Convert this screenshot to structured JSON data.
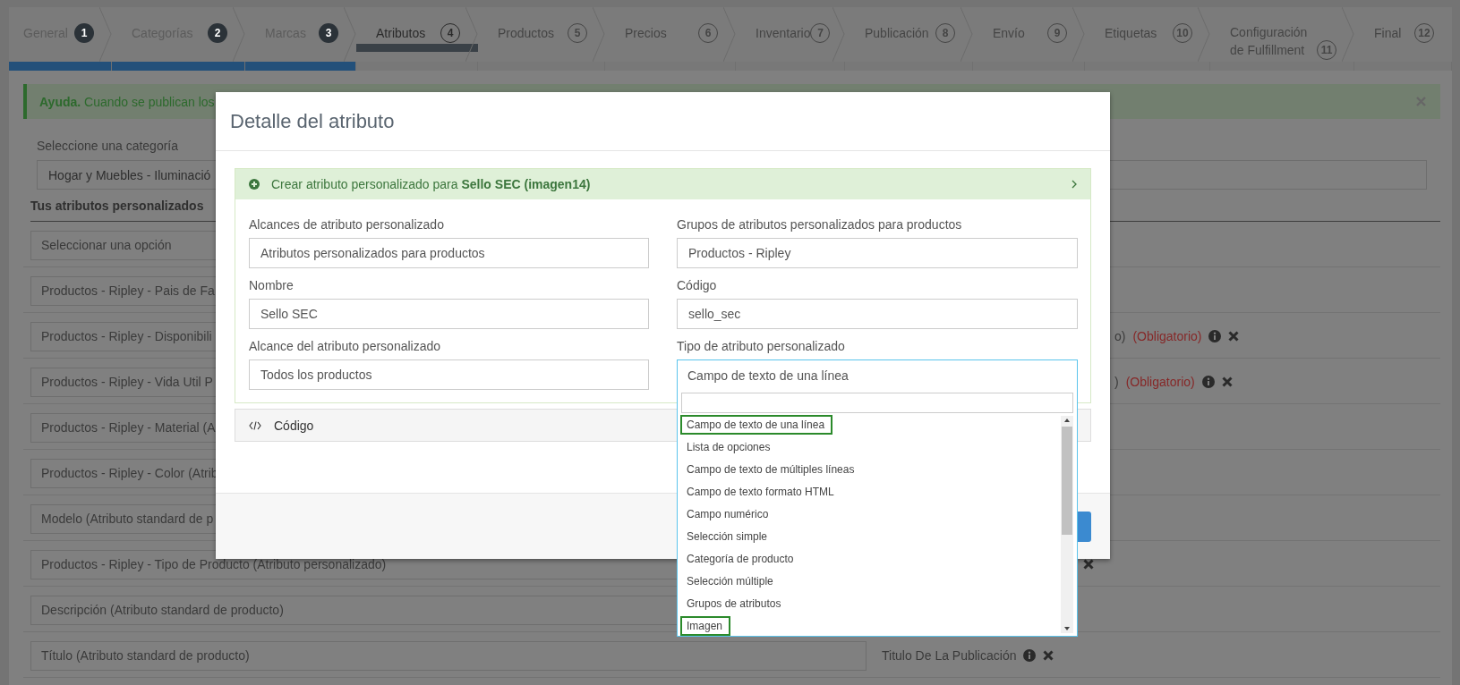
{
  "wizard": {
    "steps": [
      {
        "label": "General",
        "number": "1",
        "done": true,
        "selected": false
      },
      {
        "label": "Categorías",
        "number": "2",
        "done": true,
        "selected": false
      },
      {
        "label": "Marcas",
        "number": "3",
        "done": true,
        "selected": false
      },
      {
        "label": "Atributos",
        "number": "4",
        "done": false,
        "selected": true
      },
      {
        "label": "Productos",
        "number": "5",
        "done": false,
        "selected": false
      },
      {
        "label": "Precios",
        "number": "6",
        "done": false,
        "selected": false
      },
      {
        "label": "Inventario",
        "number": "7",
        "done": false,
        "selected": false
      },
      {
        "label": "Publicación",
        "number": "8",
        "done": false,
        "selected": false
      },
      {
        "label": "Envío",
        "number": "9",
        "done": false,
        "selected": false
      },
      {
        "label": "Etiquetas",
        "number": "10",
        "done": false,
        "selected": false
      },
      {
        "label": "Configuración de Fulfillment",
        "number": "11",
        "done": false,
        "selected": false
      },
      {
        "label": "Final",
        "number": "12",
        "done": false,
        "selected": false
      }
    ]
  },
  "help_alert": {
    "title": "Ayuda.",
    "text": "Cuando se publican los"
  },
  "category": {
    "label": "Seleccione una categoría",
    "value": "Hogar y Muebles - Iluminació"
  },
  "section_title": "Tus atributos personalizados",
  "rows": [
    {
      "text": "Seleccionar una opción"
    },
    {
      "text": "Productos - Ripley - Pais de Fa"
    },
    {
      "text": "Productos - Ripley - Disponibili",
      "right": {
        "kind": "clipped",
        "text": "o)",
        "required": "(Obligatorio)",
        "info": true,
        "remove": true
      }
    },
    {
      "text": "Productos - Ripley - Vida Util P",
      "right": {
        "kind": "clipped",
        "text": ")",
        "required": "(Obligatorio)",
        "info": true,
        "remove": true
      }
    },
    {
      "text": "Productos - Ripley - Material (A"
    },
    {
      "text": "Productos - Ripley - Color (Atrib"
    },
    {
      "text": "Modelo (Atributo standard de p"
    },
    {
      "text": "Productos - Ripley - Tipo de Producto (Atributo personalizado)",
      "right": {
        "kind": "edge",
        "remove": true
      }
    },
    {
      "text": "Descripción (Atributo standard de producto)"
    },
    {
      "text": "Título (Atributo standard de producto)",
      "right": {
        "kind": "full",
        "text": "Titulo De La Publicación",
        "info": true,
        "remove": true
      }
    }
  ],
  "modal": {
    "title": "Detalle del atributo",
    "panel_title": "Crear atributo personalizado para **Sello SEC (imagen14)**",
    "fields": [
      {
        "kind": "text",
        "label": "Alcances de atributo personalizado",
        "value": "Atributos personalizados para productos"
      },
      {
        "kind": "text",
        "label": "Grupos de atributos personalizados para productos",
        "value": "Productos - Ripley"
      },
      {
        "kind": "text",
        "label": "Nombre",
        "value": "Sello SEC"
      },
      {
        "kind": "text",
        "label": "Código",
        "value": "sello_sec"
      },
      {
        "kind": "text",
        "label": "Alcance del atributo personalizado",
        "value": "Todos los productos"
      },
      {
        "kind": "select",
        "label": "Tipo de atributo personalizado",
        "value": "Campo de texto de una línea",
        "options": [
          {
            "label": "Campo de texto de una línea",
            "outlined": true
          },
          {
            "label": "Lista de opciones",
            "outlined": false
          },
          {
            "label": "Campo de texto de múltiples líneas",
            "outlined": false
          },
          {
            "label": "Campo de texto formato HTML",
            "outlined": false
          },
          {
            "label": "Campo numérico",
            "outlined": false
          },
          {
            "label": "Selección simple",
            "outlined": false
          },
          {
            "label": "Categoría de producto",
            "outlined": false
          },
          {
            "label": "Selección múltiple",
            "outlined": false
          },
          {
            "label": "Grupos de atributos",
            "outlined": false
          },
          {
            "label": "Imagen",
            "outlined": true
          }
        ]
      }
    ],
    "code_section": "Código"
  }
}
